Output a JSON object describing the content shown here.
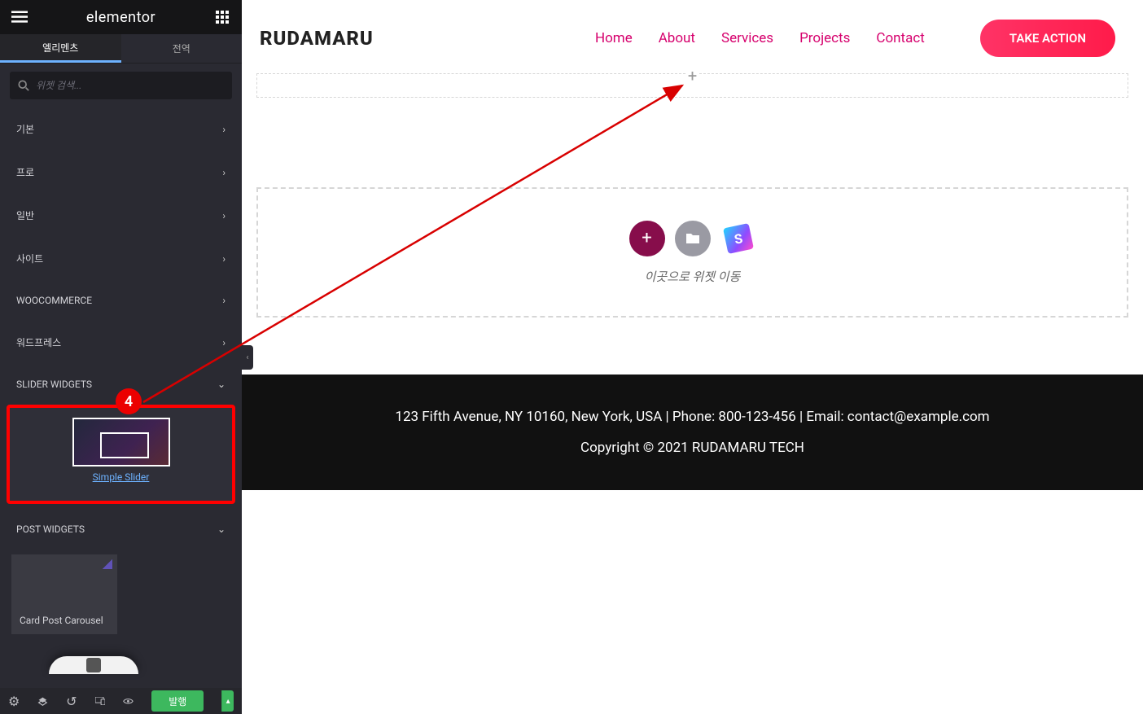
{
  "brand": "elementor",
  "tabs": {
    "elements": "엘리멘츠",
    "global": "전역"
  },
  "search": {
    "placeholder": "위젯 검색..."
  },
  "categories": {
    "basic": "기본",
    "pro": "프로",
    "general": "일반",
    "site": "사이트",
    "woocommerce": "WOOCOMMERCE",
    "wordpress": "워드프레스",
    "slider_widgets": "SLIDER WIDGETS",
    "post_widgets": "POST WIDGETS"
  },
  "widgets": {
    "simple_slider": "Simple Slider",
    "card_post_carousel": "Card Post Carousel"
  },
  "footer_actions": {
    "publish": "발행"
  },
  "preview": {
    "logo": "RUDAMARU",
    "nav": {
      "home": "Home",
      "about": "About",
      "services": "Services",
      "projects": "Projects",
      "contact": "Contact"
    },
    "cta": "TAKE ACTION",
    "drop_label": "이곳으로 위젯 이동",
    "footer_line1": "123 Fifth Avenue, NY 10160, New York, USA | Phone: 800-123-456 | Email: contact@example.com",
    "footer_line2": "Copyright © 2021 RUDAMARU TECH"
  },
  "annotation": {
    "step": "4"
  }
}
